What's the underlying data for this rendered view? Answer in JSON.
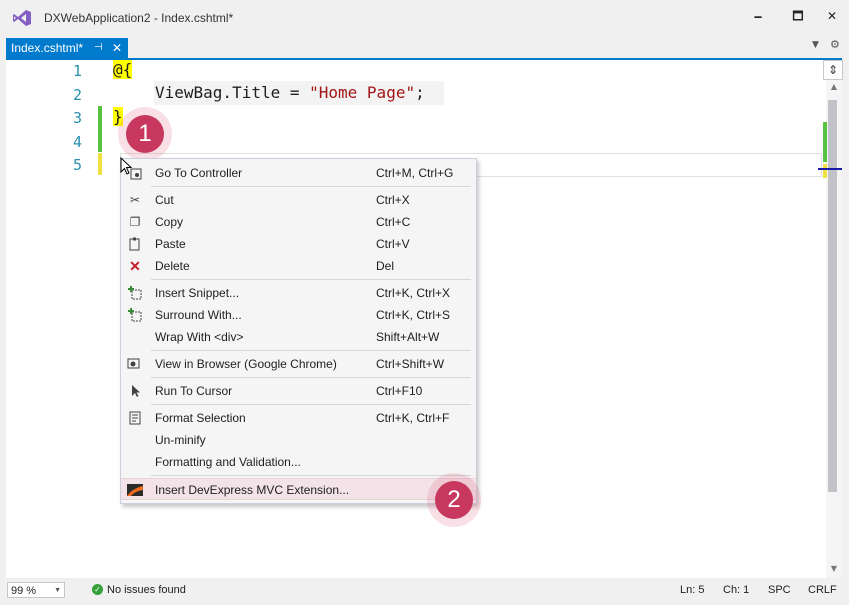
{
  "window": {
    "title": "DXWebApplication2 - Index.cshtml*",
    "minimize_glyph": "🗕",
    "restore_glyph": "🗖",
    "close_glyph": "✕"
  },
  "tab": {
    "label": "Index.cshtml*",
    "pin_glyph": "⊣",
    "close_glyph": "✕",
    "dropdown_glyph": "▼",
    "gear_glyph": "⚙"
  },
  "editor": {
    "line_numbers": [
      "1",
      "2",
      "3",
      "4",
      "5"
    ],
    "code": {
      "line1": "@{",
      "line2_prefix": "ViewBag.Title = ",
      "line2_string": "\"Home Page\"",
      "line2_suffix": ";",
      "line3": "}"
    },
    "colors": {
      "line_number": "#2b91af",
      "string": "#a31515",
      "razor_highlight": "#ffff00"
    },
    "split_glyph": "⇕",
    "scroll_up_glyph": "▲",
    "scroll_down_glyph": "▼"
  },
  "context_menu": {
    "items": [
      {
        "label": "Go To Controller",
        "shortcut": "Ctrl+M, Ctrl+G",
        "icon": "go-to-controller-icon"
      },
      {
        "label": "Cut",
        "shortcut": "Ctrl+X",
        "icon": "cut-icon"
      },
      {
        "label": "Copy",
        "shortcut": "Ctrl+C",
        "icon": "copy-icon"
      },
      {
        "label": "Paste",
        "shortcut": "Ctrl+V",
        "icon": "paste-icon"
      },
      {
        "label": "Delete",
        "shortcut": "Del",
        "icon": "delete-icon"
      },
      {
        "label": "Insert Snippet...",
        "shortcut": "Ctrl+K, Ctrl+X",
        "icon": "snippet-icon"
      },
      {
        "label": "Surround With...",
        "shortcut": "Ctrl+K, Ctrl+S",
        "icon": "surround-icon"
      },
      {
        "label": "Wrap With <div>",
        "shortcut": "Shift+Alt+W",
        "icon": ""
      },
      {
        "label": "View in Browser (Google Chrome)",
        "shortcut": "Ctrl+Shift+W",
        "icon": "browser-icon"
      },
      {
        "label": "Run To Cursor",
        "shortcut": "Ctrl+F10",
        "icon": "run-to-cursor-icon"
      },
      {
        "label": "Format Selection",
        "shortcut": "Ctrl+K, Ctrl+F",
        "icon": "format-icon"
      },
      {
        "label": "Un-minify",
        "shortcut": "",
        "icon": ""
      },
      {
        "label": "Formatting and Validation...",
        "shortcut": "",
        "icon": ""
      },
      {
        "label": "Insert DevExpress MVC Extension...",
        "shortcut": "",
        "icon": "devexpress-icon"
      }
    ],
    "glyphs": {
      "cut": "✂",
      "copy": "❐",
      "paste": "📋",
      "delete": "✕",
      "snippet": "⊞",
      "surround": "⊞",
      "browser": "▣",
      "run_to_cursor": "➤",
      "format": "☰"
    }
  },
  "badges": {
    "step1": "1",
    "step2": "2"
  },
  "statusbar": {
    "zoom": "99 %",
    "zoom_arrow": "▼",
    "ok_glyph": "✓",
    "issues": "No issues found",
    "line": "Ln: 5",
    "col": "Ch: 1",
    "mode": "SPC",
    "eol": "CRLF"
  }
}
